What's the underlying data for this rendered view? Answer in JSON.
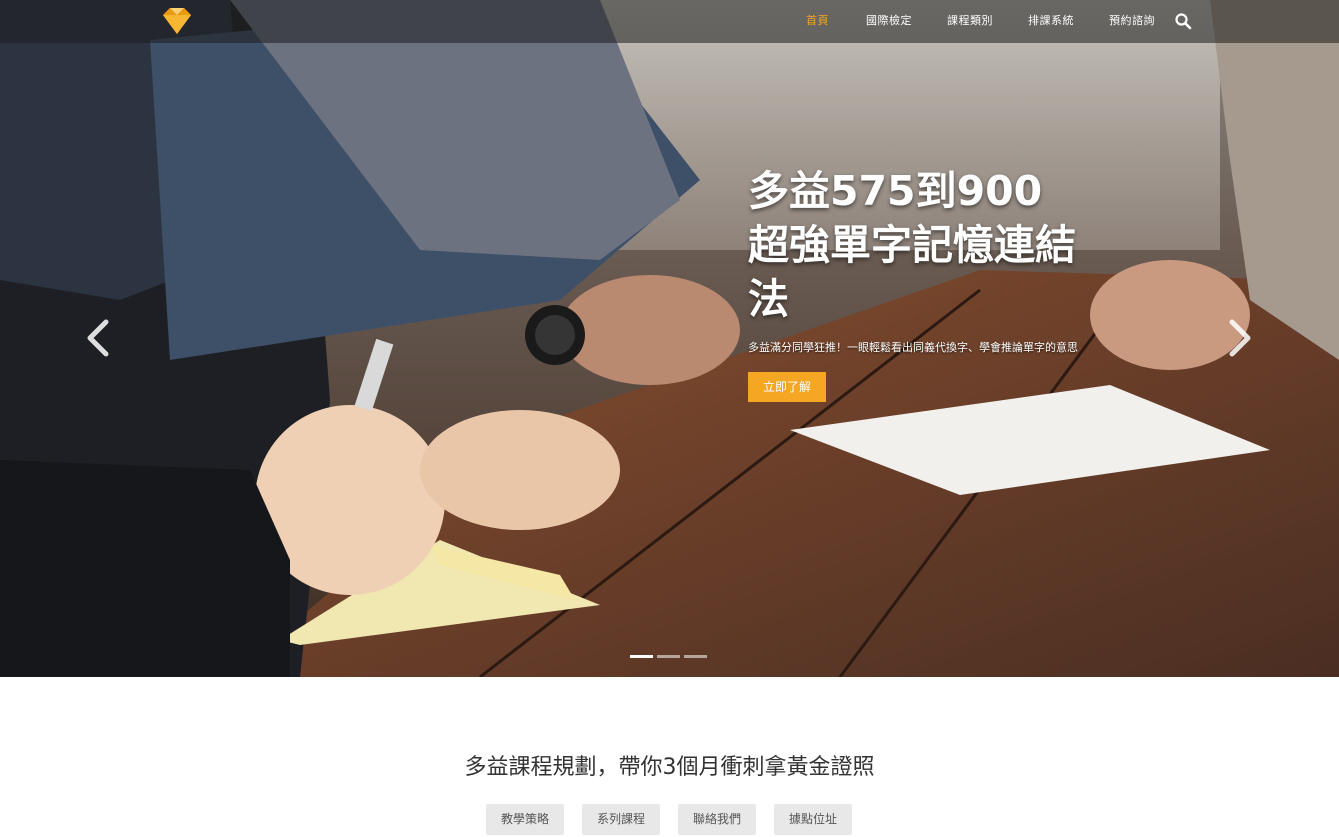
{
  "nav": {
    "logo_icon": "diamond-icon",
    "items": [
      {
        "label": "首頁",
        "active": true
      },
      {
        "label": "國際檢定",
        "active": false
      },
      {
        "label": "課程類別",
        "active": false
      },
      {
        "label": "排課系統",
        "active": false
      },
      {
        "label": "預約諮詢",
        "active": false
      }
    ],
    "search_icon": "search-icon",
    "accent_color": "#f5a623"
  },
  "hero": {
    "title_line1": "多益575到900",
    "title_line2": "超強單字記憶連結",
    "title_line3": "法",
    "subtitle": "多益滿分同學狂推！一眼輕鬆看出同義代換字、學會推論單字的意思",
    "cta_label": "立即了解",
    "prev_icon": "chevron-left-icon",
    "next_icon": "chevron-right-icon",
    "slide_count": 3,
    "active_slide": 1
  },
  "section": {
    "heading": "多益課程規劃，帶你3個月衝刺拿黃金證照",
    "tags": [
      "教學策略",
      "系列課程",
      "聯絡我們",
      "據點位址"
    ]
  }
}
